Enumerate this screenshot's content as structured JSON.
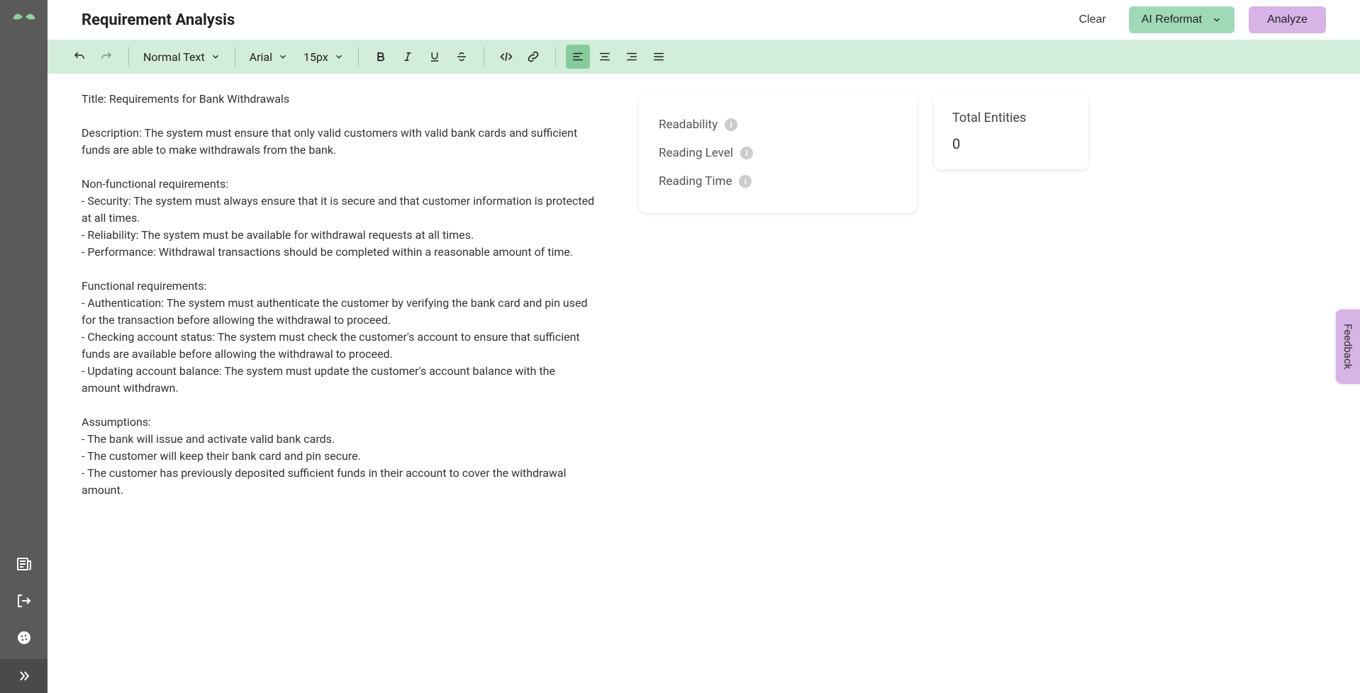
{
  "header": {
    "title": "Requirement Analysis",
    "clear": "Clear",
    "reformat": "AI Reformat",
    "analyze": "Analyze"
  },
  "toolbar": {
    "text_style": "Normal Text",
    "font": "Arial",
    "size": "15px"
  },
  "editor": {
    "lines": [
      "Title: Requirements for Bank Withdrawals",
      "",
      "Description: The system must ensure that only valid customers with valid bank cards and sufficient funds are able to make withdrawals from the bank.",
      "",
      "Non-functional requirements:",
      "- Security: The system must always ensure that it is secure and that customer information is protected at all times.",
      "- Reliability: The system must be available for withdrawal requests at all times.",
      "- Performance: Withdrawal transactions should be completed within a reasonable amount of time.",
      "",
      "Functional requirements:",
      "- Authentication: The system must authenticate the customer by verifying the bank card and pin used for the transaction before allowing the withdrawal to proceed.",
      "- Checking account status: The system must check the customer's account to ensure that sufficient funds are available before allowing the withdrawal to proceed.",
      "- Updating account balance: The system must update the customer's account balance with the amount withdrawn.",
      "",
      "Assumptions:",
      "- The bank will issue and activate valid bank cards.",
      "- The customer will keep their bank card and pin secure.",
      "- The customer has previously deposited sufficient funds in their account to cover the withdrawal amount."
    ]
  },
  "metrics": {
    "readability": "Readability",
    "reading_level": "Reading Level",
    "reading_time": "Reading Time"
  },
  "entities": {
    "title": "Total Entities",
    "value": "0"
  },
  "feedback": "Feedback"
}
